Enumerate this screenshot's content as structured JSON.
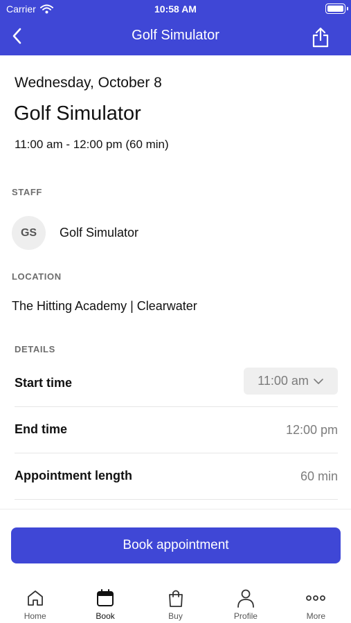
{
  "status_bar": {
    "carrier": "Carrier",
    "time": "10:58 AM"
  },
  "nav": {
    "title": "Golf Simulator"
  },
  "appointment": {
    "date": "Wednesday, October 8",
    "title": "Golf Simulator",
    "time_range": "11:00 am - 12:00 pm (60 min)"
  },
  "staff": {
    "section_label": "STAFF",
    "initials": "GS",
    "name": "Golf Simulator"
  },
  "location": {
    "section_label": "LOCATION",
    "name": "The Hitting Academy | Clearwater"
  },
  "details": {
    "section_label": "DETAILS",
    "start_time_label": "Start time",
    "start_time_value": "11:00 am",
    "end_time_label": "End time",
    "end_time_value": "12:00 pm",
    "length_label": "Appointment length",
    "length_value": "60 min"
  },
  "book_button": "Book appointment",
  "tabs": [
    {
      "label": "Home",
      "icon": "home-icon",
      "active": false
    },
    {
      "label": "Book",
      "icon": "calendar-icon",
      "active": true
    },
    {
      "label": "Buy",
      "icon": "shopping-bag-icon",
      "active": false
    },
    {
      "label": "Profile",
      "icon": "person-icon",
      "active": false
    },
    {
      "label": "More",
      "icon": "more-dots-icon",
      "active": false
    }
  ],
  "colors": {
    "brand": "#3f47d6",
    "muted_text": "#7c7c7c",
    "section_label": "#6d6d6d"
  }
}
